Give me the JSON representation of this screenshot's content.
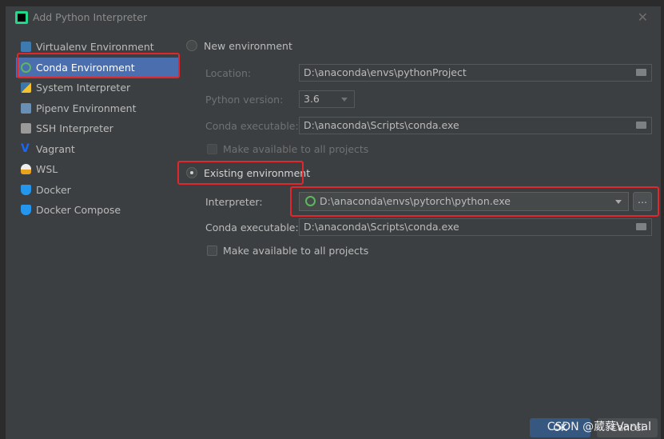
{
  "title": "Add Python Interpreter",
  "sidebar": {
    "items": [
      {
        "label": "Virtualenv Environment",
        "icon": "virtualenv-icon"
      },
      {
        "label": "Conda Environment",
        "icon": "conda-icon"
      },
      {
        "label": "System Interpreter",
        "icon": "python-icon"
      },
      {
        "label": "Pipenv Environment",
        "icon": "pipenv-icon"
      },
      {
        "label": "SSH Interpreter",
        "icon": "ssh-icon"
      },
      {
        "label": "Vagrant",
        "icon": "vagrant-icon"
      },
      {
        "label": "WSL",
        "icon": "linux-icon"
      },
      {
        "label": "Docker",
        "icon": "docker-icon"
      },
      {
        "label": "Docker Compose",
        "icon": "docker-compose-icon"
      }
    ]
  },
  "new_env": {
    "label": "New environment",
    "location_label": "Location:",
    "location_value": "D:\\anaconda\\envs\\pythonProject",
    "python_version_label": "Python version:",
    "python_version_value": "3.6",
    "conda_exec_label": "Conda executable:",
    "conda_exec_value": "D:\\anaconda\\Scripts\\conda.exe",
    "make_available_label": "Make available to all projects"
  },
  "existing_env": {
    "label": "Existing environment",
    "interpreter_label": "Interpreter:",
    "interpreter_value": "D:\\anaconda\\envs\\pytorch\\python.exe",
    "browse_label": "...",
    "conda_exec_label": "Conda executable:",
    "conda_exec_value": "D:\\anaconda\\Scripts\\conda.exe",
    "make_available_label": "Make available to all projects"
  },
  "buttons": {
    "ok": "OK",
    "cancel": "Cancel"
  },
  "watermark": "CSDN @葳蕤Vantal"
}
